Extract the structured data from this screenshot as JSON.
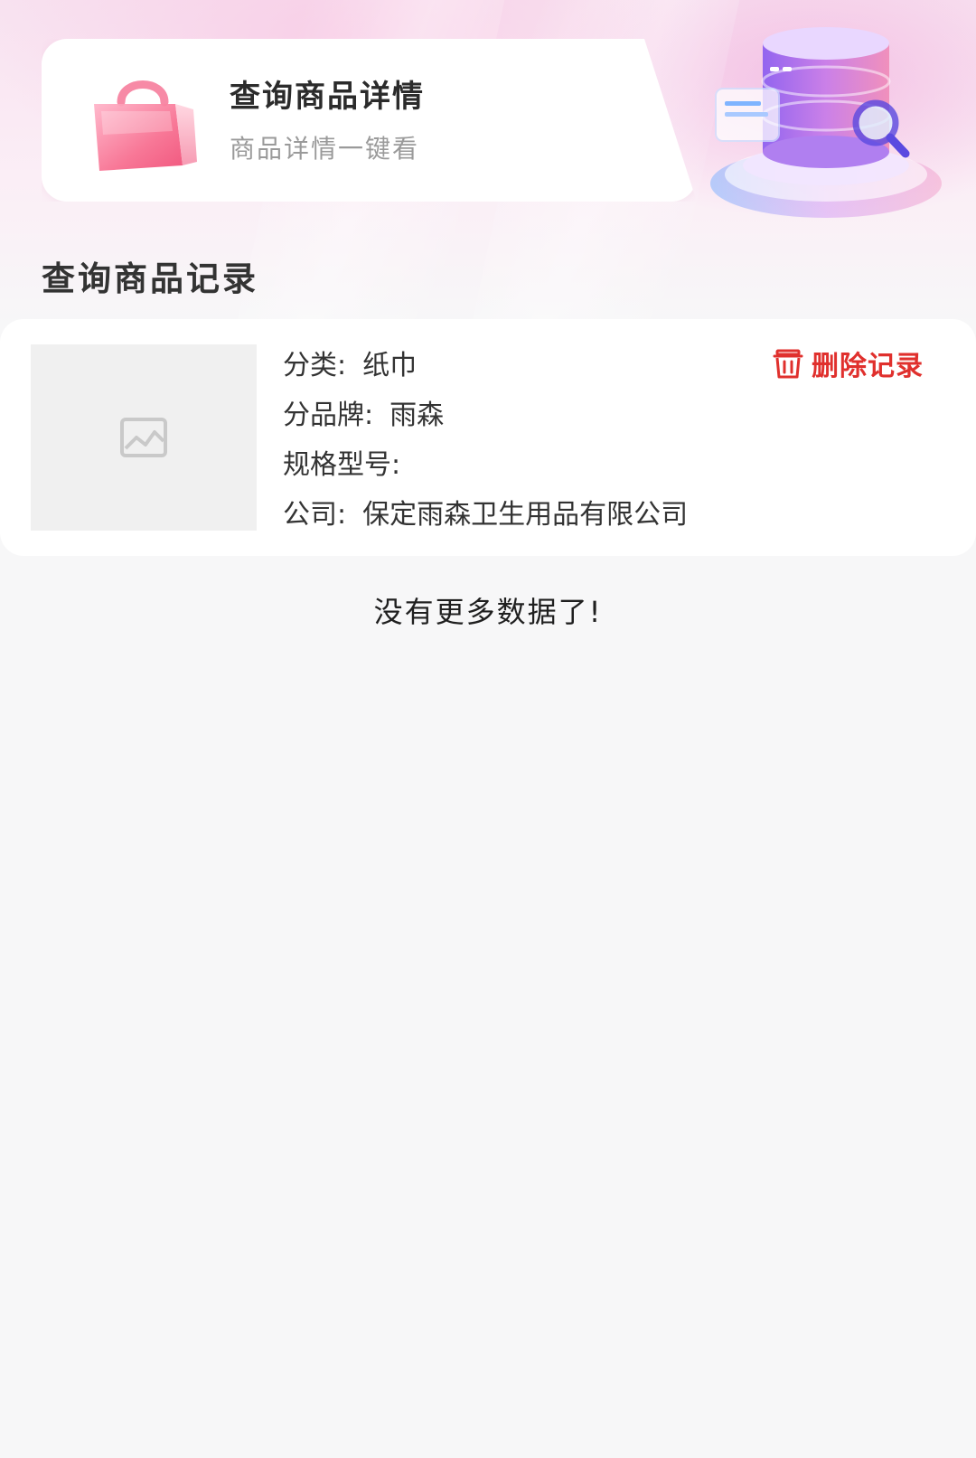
{
  "header": {
    "query_title": "查询商品详情",
    "query_subtitle": "商品详情一键看",
    "icons": {
      "bag": "shopping-bag-icon",
      "illustration": "database-search-icon"
    }
  },
  "records": {
    "section_title": "查询商品记录",
    "items": [
      {
        "category_label": "分类:",
        "category_value": "纸巾",
        "brand_label": "分品牌:",
        "brand_value": "雨森",
        "model_label": "规格型号:",
        "model_value": "",
        "company_label": "公司:",
        "company_value": "保定雨森卫生用品有限公司",
        "delete_label": "删除记录",
        "image_icon": "image-placeholder-icon"
      }
    ],
    "no_more_text": "没有更多数据了!"
  },
  "colors": {
    "accent_delete": "#e0302d",
    "hero_pink": "#f8e2f0",
    "page_background": "#f7f7f8"
  }
}
